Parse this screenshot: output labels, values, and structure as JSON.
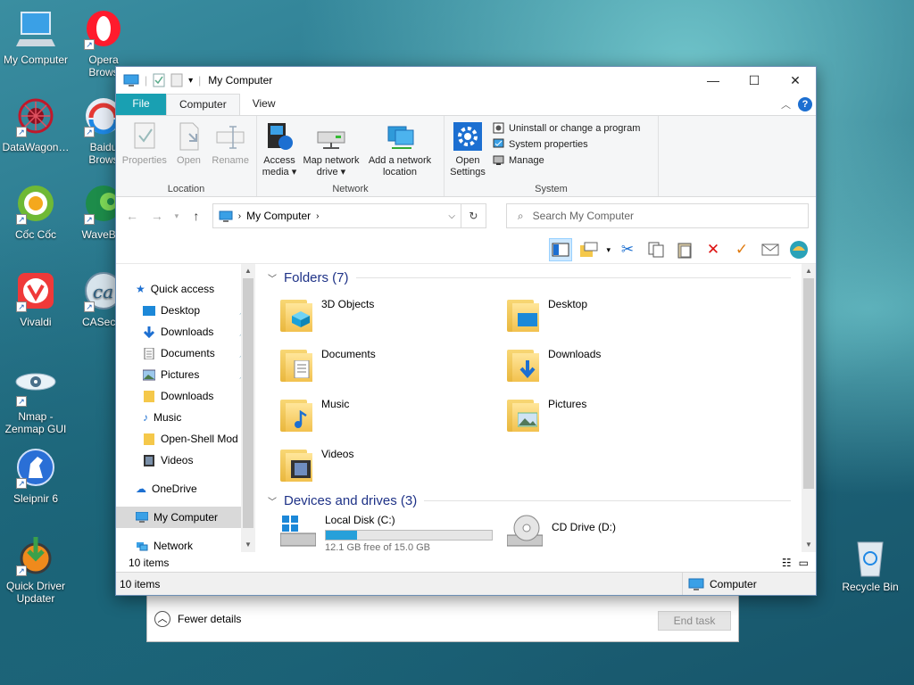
{
  "desktop": {
    "icons_left": [
      {
        "label": "My Computer",
        "icon": "computer-icon"
      },
      {
        "label": "DataWagon…",
        "icon": "datawagon-icon"
      },
      {
        "label": "Cốc Cốc",
        "icon": "coccoc-icon"
      },
      {
        "label": "Vivaldi",
        "icon": "vivaldi-icon"
      },
      {
        "label": "Nmap -\nZenmap GUI",
        "icon": "nmap-icon"
      },
      {
        "label": "Sleipnir 6",
        "icon": "sleipnir-icon"
      },
      {
        "label": "Quick Driver\nUpdater",
        "icon": "quick-driver-icon"
      }
    ],
    "icons_col2": [
      {
        "label": "Opera Brows",
        "icon": "opera-icon"
      },
      {
        "label": "Baidu Brows",
        "icon": "baidu-icon"
      },
      {
        "label": "WaveBro",
        "icon": "wavebrowser-icon"
      },
      {
        "label": "CASecur",
        "icon": "casecure-icon"
      }
    ],
    "recycle_bin": "Recycle Bin"
  },
  "task_manager": {
    "fewer_details": "Fewer details",
    "end_task": "End task"
  },
  "explorer": {
    "title": "My Computer",
    "tabs": [
      "File",
      "Computer",
      "View"
    ],
    "active_tab": "Computer",
    "ribbon": {
      "location": {
        "label": "Location",
        "buttons": [
          "Properties",
          "Open",
          "Rename"
        ]
      },
      "network": {
        "label": "Network",
        "buttons": [
          "Access\nmedia ▾",
          "Map network\ndrive ▾",
          "Add a network\nlocation"
        ]
      },
      "system": {
        "label": "System",
        "open_settings": "Open\nSettings",
        "items": [
          "Uninstall or change a program",
          "System properties",
          "Manage"
        ]
      }
    },
    "address": {
      "path": "My Computer",
      "search_placeholder": "Search My Computer"
    },
    "nav": {
      "quick_access": "Quick access",
      "items": [
        {
          "label": "Desktop",
          "pinned": true
        },
        {
          "label": "Downloads",
          "pinned": true
        },
        {
          "label": "Documents",
          "pinned": true
        },
        {
          "label": "Pictures",
          "pinned": true
        },
        {
          "label": "Downloads",
          "pinned": false
        },
        {
          "label": "Music",
          "pinned": false
        },
        {
          "label": "Open-Shell Mod",
          "pinned": false
        },
        {
          "label": "Videos",
          "pinned": false
        }
      ],
      "onedrive": "OneDrive",
      "my_computer": "My Computer",
      "network": "Network"
    },
    "folders_header": "Folders (7)",
    "folders": [
      {
        "label": "3D Objects",
        "icon": "3d-objects-icon"
      },
      {
        "label": "Desktop",
        "icon": "desktop-folder-icon"
      },
      {
        "label": "Documents",
        "icon": "documents-folder-icon"
      },
      {
        "label": "Downloads",
        "icon": "downloads-folder-icon"
      },
      {
        "label": "Music",
        "icon": "music-folder-icon"
      },
      {
        "label": "Pictures",
        "icon": "pictures-folder-icon"
      },
      {
        "label": "Videos",
        "icon": "videos-folder-icon"
      }
    ],
    "drives_header": "Devices and drives (3)",
    "drives": [
      {
        "label": "Local Disk (C:)",
        "free_text": "12.1 GB free of 15.0 GB",
        "used_fraction": 0.19
      },
      {
        "label": "CD Drive (D:)"
      }
    ],
    "item_count": "10 items",
    "status": {
      "count": "10 items",
      "location": "Computer"
    }
  }
}
